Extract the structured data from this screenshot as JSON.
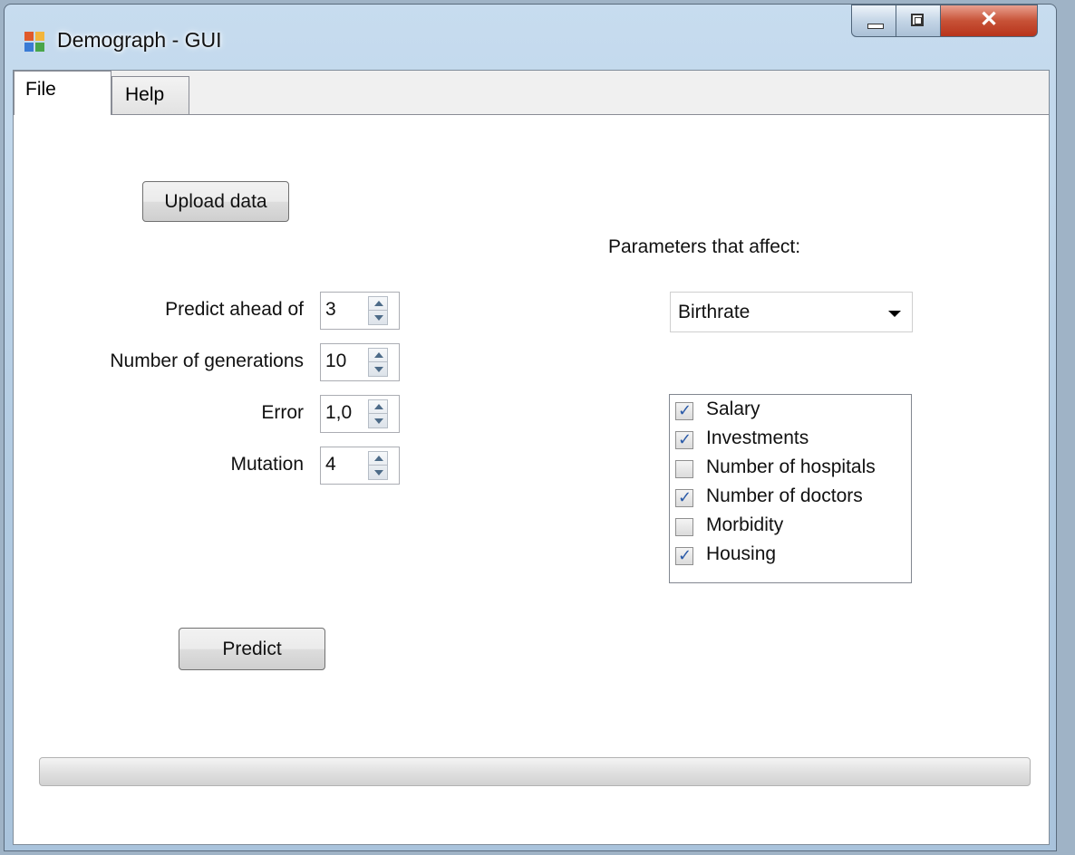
{
  "window": {
    "title": "Demograph - GUI"
  },
  "tabs": [
    {
      "label": "File",
      "active": true
    },
    {
      "label": "Help",
      "active": false
    }
  ],
  "buttons": {
    "upload": "Upload data",
    "predict": "Predict"
  },
  "fields": {
    "predict_ahead": {
      "label": "Predict ahead of",
      "value": "3"
    },
    "generations": {
      "label": "Number of generations",
      "value": "10"
    },
    "error": {
      "label": "Error",
      "value": "1,0"
    },
    "mutation": {
      "label": "Mutation",
      "value": "4"
    }
  },
  "parameters": {
    "heading": "Parameters that affect:",
    "selected": "Birthrate",
    "items": [
      {
        "label": "Salary",
        "checked": true
      },
      {
        "label": "Investments",
        "checked": true
      },
      {
        "label": "Number of hospitals",
        "checked": false
      },
      {
        "label": "Number of doctors",
        "checked": true
      },
      {
        "label": "Morbidity",
        "checked": false
      },
      {
        "label": "Housing",
        "checked": true
      }
    ]
  },
  "progress": {
    "fraction": 0
  },
  "icons": {
    "app": "window-app-icon",
    "minimize": "minimize-icon",
    "maximize": "maximize-icon",
    "close": "close-icon"
  },
  "colors": {
    "titlebar": "#b7cee4",
    "close_button": "#c75237",
    "progress_fill": "#06b025"
  }
}
